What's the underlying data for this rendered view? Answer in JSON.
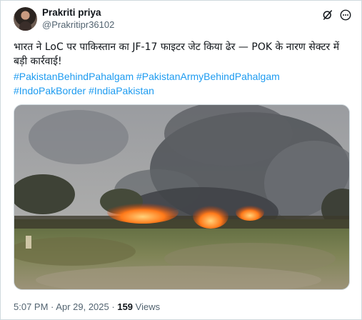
{
  "author": {
    "display_name": "Prakriti priya",
    "handle": "@Prakritipr36102"
  },
  "header_icons": [
    "grok-icon",
    "more-options-icon"
  ],
  "tweet": {
    "text": "भारत ने LoC पर पाकिस्तान का JF-17 फाइटर जेट किया ढेर — POK के नारण सेक्टर में बड़ी कार्रवाई!",
    "hashtags": [
      "#PakistanBehindPahalgam",
      "#PakistanArmyBehindPahalgam",
      "#IndoPakBorder",
      "#IndiaPakistan"
    ]
  },
  "media": {
    "type": "video",
    "icon": "video-thumbnail"
  },
  "meta": {
    "time": "5:07 PM",
    "separator": "·",
    "date": "Apr 29, 2025",
    "views_count": "159",
    "views_label": "Views"
  },
  "colors": {
    "link": "#1d9bf0",
    "secondary_text": "#536471",
    "primary_text": "#0f1419",
    "border": "#cfd9de"
  }
}
